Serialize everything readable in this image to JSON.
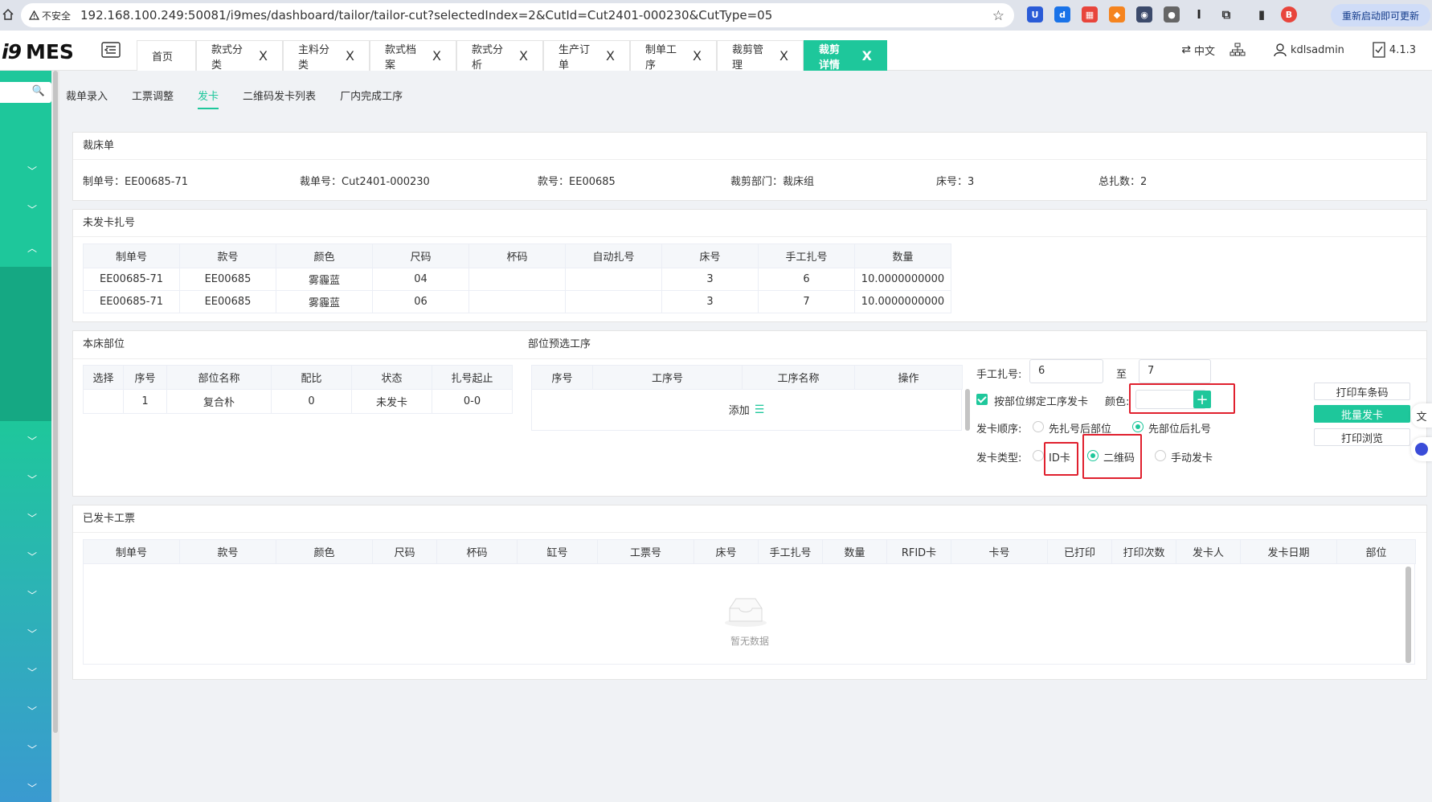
{
  "browser": {
    "insecure_label": "不安全",
    "url": "192.168.100.249:50081/i9mes/dashboard/tailor/tailor-cut?selectedIndex=2&CutId=Cut2401-000230&CutType=05",
    "update_label": "重新启动即可更新",
    "profile_letter": "B"
  },
  "app": {
    "logo_main": "i9",
    "logo_sub": "MES",
    "tabs": [
      {
        "label": "首页",
        "closable": false
      },
      {
        "label": "款式分类",
        "closable": true
      },
      {
        "label": "主料分类",
        "closable": true
      },
      {
        "label": "款式档案",
        "closable": true
      },
      {
        "label": "款式分析",
        "closable": true
      },
      {
        "label": "生产订单",
        "closable": true
      },
      {
        "label": "制单工序",
        "closable": true
      },
      {
        "label": "裁剪管理",
        "closable": true
      },
      {
        "label": "裁剪详情",
        "closable": true,
        "active": true
      }
    ],
    "close_glyph": "X",
    "lang": "中文",
    "user": "kdlsadmin",
    "version": "4.1.3"
  },
  "subnav": [
    "裁单录入",
    "工票调整",
    "发卡",
    "二维码发卡列表",
    "厂内完成工序"
  ],
  "subnav_active": 2,
  "cut_bed": {
    "title": "裁床单",
    "fields": [
      {
        "label": "制单号：",
        "value": "EE00685-71"
      },
      {
        "label": "裁单号：",
        "value": "Cut2401-000230"
      },
      {
        "label": "款号：",
        "value": "EE00685"
      },
      {
        "label": "裁剪部门：",
        "value": "裁床组"
      },
      {
        "label": "床号：",
        "value": "3"
      },
      {
        "label": "总扎数：",
        "value": "2"
      }
    ]
  },
  "unissued": {
    "title": "未发卡扎号",
    "headers": [
      "制单号",
      "款号",
      "颜色",
      "尺码",
      "杯码",
      "自动扎号",
      "床号",
      "手工扎号",
      "数量"
    ],
    "rows": [
      [
        "EE00685-71",
        "EE00685",
        "雾霾蓝",
        "04",
        "",
        "",
        "3",
        "6",
        "10.0000000000"
      ],
      [
        "EE00685-71",
        "EE00685",
        "雾霾蓝",
        "06",
        "",
        "",
        "3",
        "7",
        "10.0000000000"
      ]
    ]
  },
  "parts": {
    "title": "本床部位",
    "headers": [
      "选择",
      "序号",
      "部位名称",
      "配比",
      "状态",
      "扎号起止"
    ],
    "rows": [
      [
        "",
        "1",
        "复合朴",
        "0",
        "未发卡",
        "0-0"
      ]
    ]
  },
  "preselect": {
    "title": "部位预选工序",
    "headers": [
      "序号",
      "工序号",
      "工序名称",
      "操作"
    ],
    "add_label": "添加"
  },
  "issue_form": {
    "manual_label": "手工扎号:",
    "from": "6",
    "to_label": "至",
    "to": "7",
    "bind_label": "按部位绑定工序发卡",
    "color_label": "颜色:",
    "color_value": "",
    "order_label": "发卡顺序:",
    "order_opt1": "先扎号后部位",
    "order_opt2": "先部位后扎号",
    "type_label": "发卡类型:",
    "type_opt1": "ID卡",
    "type_opt2": "二维码",
    "type_opt3": "手动发卡",
    "btn_print_barcode": "打印车条码",
    "btn_batch": "批量发卡",
    "btn_preview": "打印浏览"
  },
  "issued": {
    "title": "已发卡工票",
    "headers": [
      "制单号",
      "款号",
      "颜色",
      "尺码",
      "杯码",
      "缸号",
      "工票号",
      "床号",
      "手工扎号",
      "数量",
      "RFID卡",
      "卡号",
      "已打印",
      "打印次数",
      "发卡人",
      "发卡日期",
      "部位"
    ],
    "empty": "暂无数据"
  },
  "colors": {
    "accent": "#1ec79b",
    "highlight": "#e0202e"
  }
}
